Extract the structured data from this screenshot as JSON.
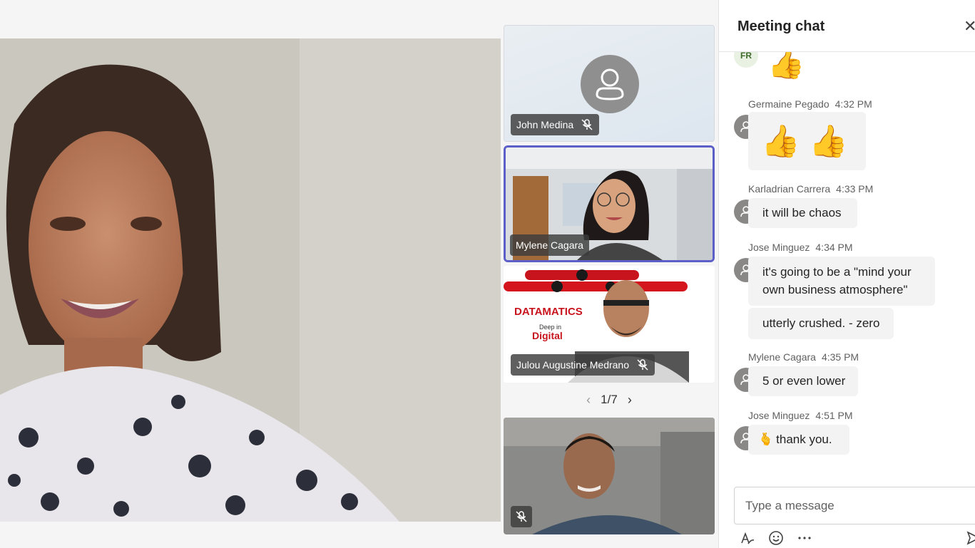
{
  "participants": {
    "john": {
      "name": "John Medina",
      "mic_icon": "mic-off-icon"
    },
    "mylene": {
      "name": "Mylene Cagara"
    },
    "julou": {
      "name": "Julou Augustine Medrano",
      "mic_icon": "mic-off-icon",
      "banner_brand": "DATAMATICS",
      "banner_tagline_1": "Deep in",
      "banner_tagline_2": "Digital"
    },
    "fourth": {
      "mic_icon": "mic-off-icon"
    }
  },
  "pager": {
    "label": "1/7",
    "prev_icon": "chevron-left-icon",
    "next_icon": "chevron-right-icon"
  },
  "chat": {
    "title": "Meeting chat",
    "close_icon": "close-icon",
    "messages": [
      {
        "avatar_initials": "FR",
        "body": "👍"
      },
      {
        "sender": "Germaine Pegado",
        "time": "4:32 PM",
        "body": "👍 👍"
      },
      {
        "sender": "Karladrian Carrera",
        "time": "4:33 PM",
        "body": "it will be chaos"
      },
      {
        "sender": "Jose Minguez",
        "time": "4:34 PM",
        "body": "it's going to be a \"mind your own business atmosphere\""
      },
      {
        "body": "utterly crushed. - zero"
      },
      {
        "sender": "Mylene Cagara",
        "time": "4:35 PM",
        "body": "5 or even lower"
      },
      {
        "sender": "Jose Minguez",
        "time": "4:51 PM",
        "emoji": "🫰",
        "body": "thank you."
      }
    ],
    "composer": {
      "placeholder": "Type a message"
    },
    "toolbar": {
      "format_icon": "format-icon",
      "emoji_icon": "emoji-icon",
      "more_icon": "more-options-icon",
      "send_icon": "send-icon"
    }
  },
  "colors": {
    "accent": "#5b5fc7",
    "bubble": "#f3f3f3",
    "avatar": "#8a8886"
  }
}
